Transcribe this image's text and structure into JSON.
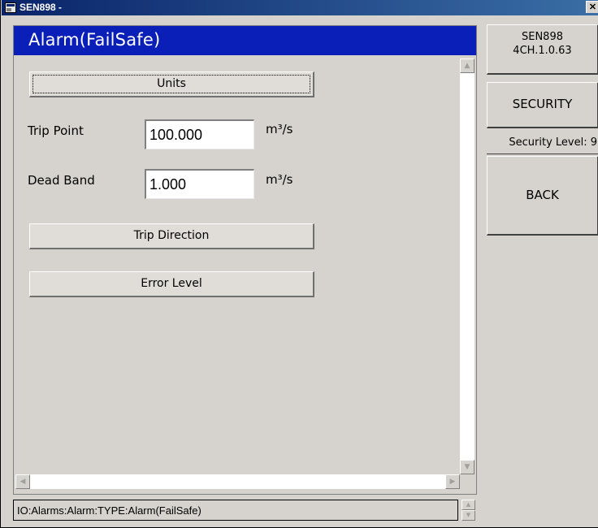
{
  "window": {
    "title": "SEN898 -",
    "close_symbol": "✕"
  },
  "screen": {
    "title": "Alarm(FailSafe)"
  },
  "buttons": {
    "units": "Units",
    "trip_direction": "Trip Direction",
    "error_level": "Error Level"
  },
  "fields": {
    "trip_point": {
      "label": "Trip Point",
      "value": "100.000",
      "unit": "m³/s"
    },
    "dead_band": {
      "label": "Dead Band",
      "value": "1.000",
      "unit": "m³/s"
    }
  },
  "sidebar": {
    "device_name": "SEN898",
    "device_version": "4CH.1.0.63",
    "security_label": "SECURITY",
    "security_level": "Security Level: 9",
    "back_label": "BACK"
  },
  "status_bar": {
    "path": "IO:Alarms:Alarm:TYPE:Alarm(FailSafe)"
  },
  "icons": {
    "app": "window-app-icon",
    "close": "close-icon",
    "scroll_up": "arrow-up-icon",
    "scroll_down": "arrow-down-icon",
    "scroll_left": "arrow-left-icon",
    "scroll_right": "arrow-right-icon"
  },
  "colors": {
    "title_bar": "#0a246a",
    "screen_header": "#0a1eb8",
    "panel": "#d6d3ce"
  }
}
